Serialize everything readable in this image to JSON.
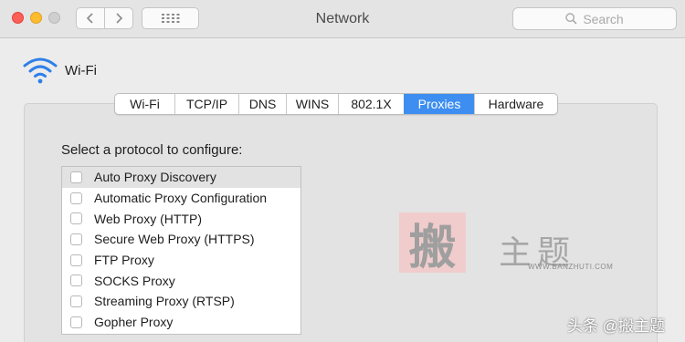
{
  "window": {
    "title": "Network",
    "search_placeholder": "Search"
  },
  "icons": {
    "wifi": "wifi-icon",
    "back": "chevron-left-icon",
    "forward": "chevron-right-icon",
    "grid": "grid-icon",
    "search": "search-icon"
  },
  "header": {
    "interface_name": "Wi-Fi"
  },
  "tabs": [
    {
      "label": "Wi-Fi"
    },
    {
      "label": "TCP/IP"
    },
    {
      "label": "DNS"
    },
    {
      "label": "WINS"
    },
    {
      "label": "802.1X"
    },
    {
      "label": "Proxies",
      "active": true
    },
    {
      "label": "Hardware"
    }
  ],
  "proxies": {
    "prompt": "Select a protocol to configure:",
    "protocols": [
      {
        "label": "Auto Proxy Discovery",
        "checked": false,
        "selected": true
      },
      {
        "label": "Automatic Proxy Configuration",
        "checked": false
      },
      {
        "label": "Web Proxy (HTTP)",
        "checked": false
      },
      {
        "label": "Secure Web Proxy (HTTPS)",
        "checked": false
      },
      {
        "label": "FTP Proxy",
        "checked": false
      },
      {
        "label": "SOCKS Proxy",
        "checked": false
      },
      {
        "label": "Streaming Proxy (RTSP)",
        "checked": false
      },
      {
        "label": "Gopher Proxy",
        "checked": false
      }
    ]
  },
  "watermark": {
    "seal_char": "搬",
    "text": "主题",
    "url": "WWW.BANZHUTI.COM",
    "credit": "头条 @搬主题"
  },
  "colors": {
    "accent": "#3d8ef0",
    "close": "#fc5f57",
    "minimize": "#fdbc2e"
  }
}
